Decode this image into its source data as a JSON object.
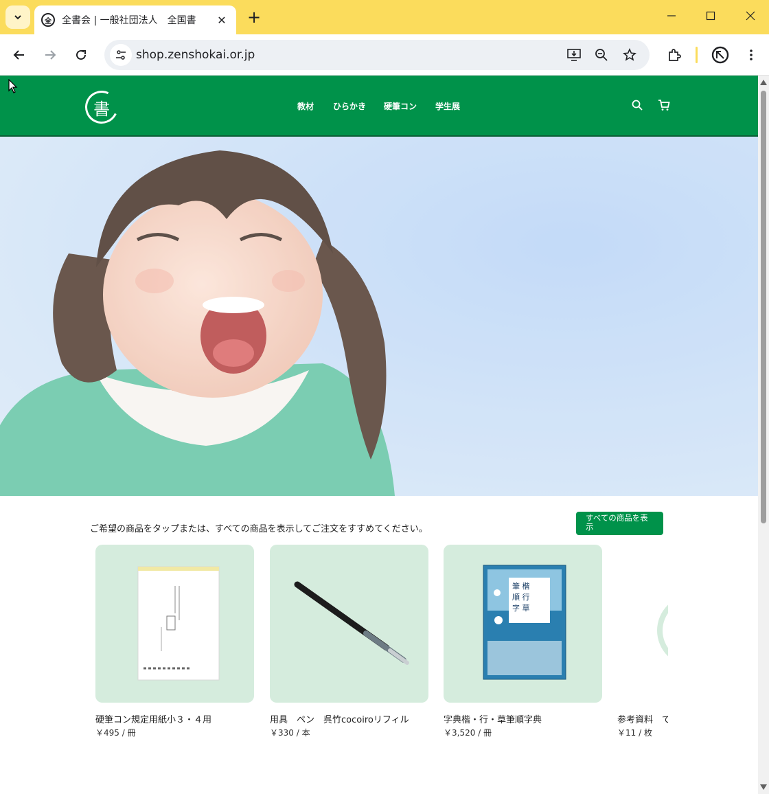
{
  "browser": {
    "tab": {
      "title": "全書会 | 一般社団法人　全国書",
      "favicon": "zenshokai-logo-icon"
    },
    "url": "shop.zenshokai.or.jp",
    "window_controls": [
      "minimize",
      "maximize",
      "close"
    ]
  },
  "header": {
    "logo_char": "書",
    "nav": [
      {
        "label": "教材"
      },
      {
        "label": "ひらかき"
      },
      {
        "label": "硬筆コン"
      },
      {
        "label": "学生展"
      }
    ],
    "icons": [
      "search-icon",
      "cart-icon"
    ],
    "brand_color": "#00924a"
  },
  "hero": {
    "description_icon": "hero-photo-smiling-girl"
  },
  "main": {
    "intro_text": "ご希望の商品をタップまたは、すべての商品を表示してご注文をすすめてください。",
    "all_products_button": "すべての商品を表示"
  },
  "products": [
    {
      "name": "硬筆コン規定用紙小３・４用",
      "price": "￥495 / 冊"
    },
    {
      "name": "用具　ペン　呉竹cocoiroリフィル",
      "price": "￥330 / 本"
    },
    {
      "name": "字典楷・行・草筆順字典",
      "price": "￥3,520 / 冊"
    },
    {
      "name": "参考資料　て",
      "price": "￥11 / 枚"
    }
  ]
}
